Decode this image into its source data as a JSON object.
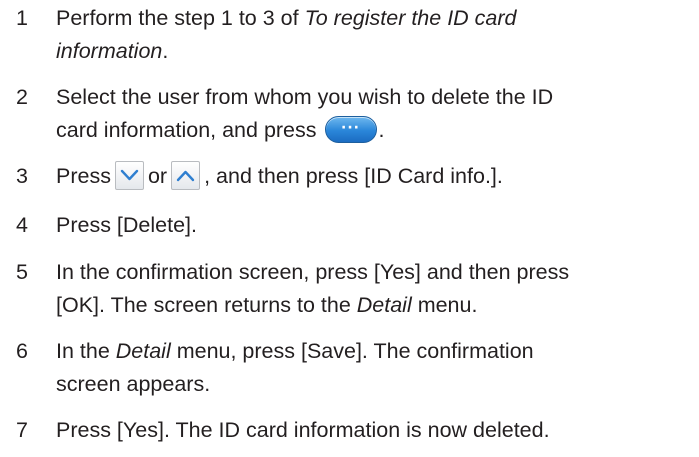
{
  "steps": [
    {
      "number": "1",
      "line1": "Perform the step 1 to 3 of ",
      "line1_italic": "To register the ID card",
      "line2_italic": "information",
      "line2_tail": "."
    },
    {
      "number": "2",
      "line1": "Select the user from whom you wish to delete the ID",
      "line2": "card information, and press",
      "line2_tail": ".",
      "button_icon": "more-options-pill-button-icon",
      "button_glyph": "···"
    },
    {
      "number": "3",
      "press": "Press",
      "or": "or",
      "tail": ", and then press [ID Card info.].",
      "down_icon": "scroll-down-arrow-icon",
      "up_icon": "scroll-up-arrow-icon"
    },
    {
      "number": "4",
      "text": "Press [Delete]."
    },
    {
      "number": "5",
      "line1": "In the confirmation screen, press [Yes] and then press",
      "line2": "[OK]. The screen returns to the ",
      "line2_italic": "Detail",
      "line2_tail": " menu."
    },
    {
      "number": "6",
      "line1_head": "In the ",
      "line1_italic": "Detail",
      "line1_tail": " menu, press [Save]. The confirmation",
      "line2": "screen appears."
    },
    {
      "number": "7",
      "text": "Press [Yes]. The ID card information is now deleted."
    }
  ],
  "colors": {
    "text": "#231f20",
    "pill_button": "#2a86d9",
    "arrow_button_border": "#b9bcc0",
    "arrow_glyph": "#2f7fd0"
  }
}
